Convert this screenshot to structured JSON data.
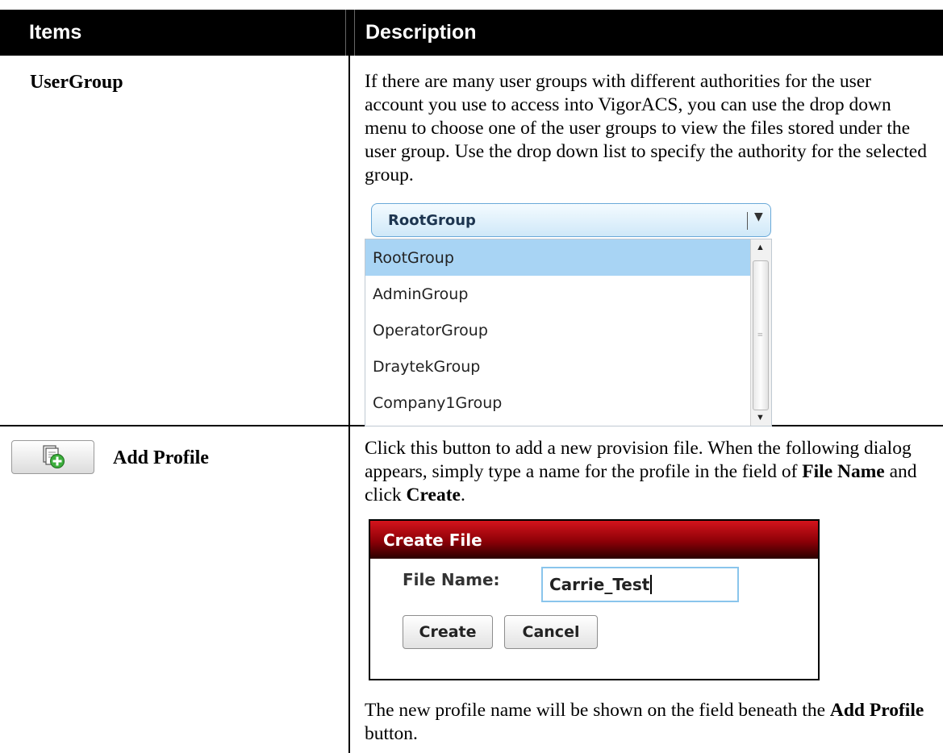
{
  "table": {
    "header_items": "Items",
    "header_description": "Description"
  },
  "usergroup": {
    "label": "UserGroup",
    "description": "If there are many user groups with different authorities for the user account you use to access into VigorACS, you can use the drop down menu to choose one of the user groups to view the files stored under the user group. Use the drop down list to specify the authority for the selected group.",
    "dropdown": {
      "selected": "RootGroup",
      "options": [
        "RootGroup",
        "AdminGroup",
        "OperatorGroup",
        "DraytekGroup",
        "Company1Group"
      ]
    }
  },
  "add_profile": {
    "label": "Add Profile",
    "icon": "add-file-icon",
    "desc_part1": "Click this button to add a new provision file. When the following dialog appears, simply type a name for the profile in the field of ",
    "desc_bold1": "File Name",
    "desc_part2": " and click ",
    "desc_bold2": "Create",
    "desc_part3": ".",
    "dialog": {
      "title": "Create File",
      "field_label": "File Name:",
      "field_value": "Carrie_Test",
      "create_label": "Create",
      "cancel_label": "Cancel"
    },
    "note_part1": "The new profile name will be shown on the field beneath the ",
    "note_bold": "Add Profile",
    "note_part2": " button."
  },
  "colors": {
    "header_bg": "#000000",
    "dialog_title": "#b0000a",
    "selected_option": "#a8d4f4"
  }
}
